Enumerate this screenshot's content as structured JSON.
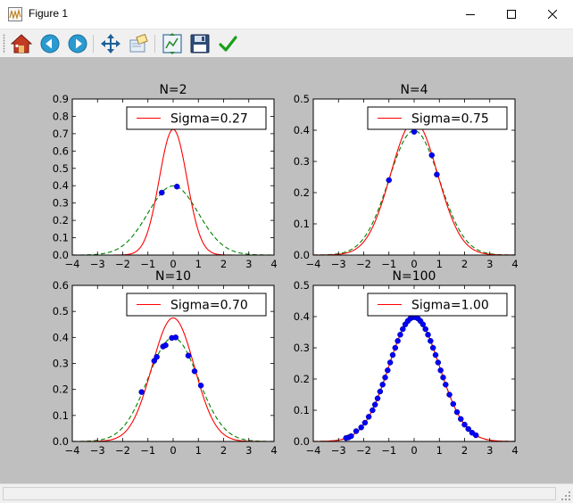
{
  "window": {
    "title": "Figure 1",
    "buttons": {
      "minimize": "minimize",
      "maximize": "maximize",
      "close": "close"
    }
  },
  "toolbar": {
    "tools": [
      {
        "name": "home-icon",
        "label": "Home"
      },
      {
        "name": "back-icon",
        "label": "Back"
      },
      {
        "name": "forward-icon",
        "label": "Forward"
      },
      {
        "name": "pan-icon",
        "label": "Pan"
      },
      {
        "name": "zoom-icon",
        "label": "Zoom"
      },
      {
        "name": "subplots-icon",
        "label": "Subplots"
      },
      {
        "name": "save-icon",
        "label": "Save"
      },
      {
        "name": "edit-icon",
        "label": "Edit"
      }
    ]
  },
  "colors": {
    "fit_line": "#ff0000",
    "true_density": "#007f00",
    "points": "#0000ff",
    "figure_bg": "#bfbfbf",
    "axes_bg": "#ffffff"
  },
  "chart_data": [
    {
      "type": "line",
      "title": "N=2",
      "xlim": [
        -4,
        4
      ],
      "ylim": [
        0,
        0.9
      ],
      "xticks": [
        -4,
        -3,
        -2,
        -1,
        0,
        1,
        2,
        3,
        4
      ],
      "yticks": [
        0.0,
        0.1,
        0.2,
        0.3,
        0.4,
        0.5,
        0.6,
        0.7,
        0.8,
        0.9
      ],
      "ytick_labels": [
        "0.0",
        "0.1",
        "0.2",
        "0.3",
        "0.4",
        "0.5",
        "0.6",
        "0.7",
        "0.8",
        "0.9"
      ],
      "legend": {
        "label": "Sigma=0.27",
        "loc": "top-right"
      },
      "series": [
        {
          "name": "Sigma=0.27",
          "kind": "gaussian",
          "mu": 0.0,
          "sigma": 0.55,
          "color": "#ff0000",
          "style": "solid"
        },
        {
          "kind": "gaussian",
          "mu": 0.0,
          "sigma": 1.0,
          "color": "#007f00",
          "style": "dashed"
        }
      ],
      "points": [
        [
          -0.45,
          0.36
        ],
        [
          0.15,
          0.395
        ]
      ]
    },
    {
      "type": "line",
      "title": "N=4",
      "xlim": [
        -4,
        4
      ],
      "ylim": [
        0,
        0.5
      ],
      "xticks": [
        -4,
        -3,
        -2,
        -1,
        0,
        1,
        2,
        3,
        4
      ],
      "yticks": [
        0.0,
        0.1,
        0.2,
        0.3,
        0.4,
        0.5
      ],
      "ytick_labels": [
        "0.0",
        "0.1",
        "0.2",
        "0.3",
        "0.4",
        "0.5"
      ],
      "legend": {
        "label": "Sigma=0.75",
        "loc": "top-right"
      },
      "series": [
        {
          "name": "Sigma=0.75",
          "kind": "gaussian",
          "mu": 0.0,
          "sigma": 0.93,
          "color": "#ff0000",
          "style": "solid"
        },
        {
          "kind": "gaussian",
          "mu": 0.0,
          "sigma": 1.0,
          "color": "#007f00",
          "style": "dashed"
        }
      ],
      "points": [
        [
          -1.0,
          0.24
        ],
        [
          0.0,
          0.395
        ],
        [
          0.7,
          0.32
        ],
        [
          0.9,
          0.258
        ]
      ]
    },
    {
      "type": "line",
      "title": "N=10",
      "xlim": [
        -4,
        4
      ],
      "ylim": [
        0,
        0.6
      ],
      "xticks": [
        -4,
        -3,
        -2,
        -1,
        0,
        1,
        2,
        3,
        4
      ],
      "yticks": [
        0.0,
        0.1,
        0.2,
        0.3,
        0.4,
        0.5,
        0.6
      ],
      "ytick_labels": [
        "0.0",
        "0.1",
        "0.2",
        "0.3",
        "0.4",
        "0.5",
        "0.6"
      ],
      "legend": {
        "label": "Sigma=0.70",
        "loc": "top-right"
      },
      "series": [
        {
          "name": "Sigma=0.70",
          "kind": "gaussian",
          "mu": 0.0,
          "sigma": 0.84,
          "color": "#ff0000",
          "style": "solid"
        },
        {
          "kind": "gaussian",
          "mu": 0.0,
          "sigma": 1.0,
          "color": "#007f00",
          "style": "dashed"
        }
      ],
      "points": [
        [
          -1.25,
          0.19
        ],
        [
          -0.75,
          0.31
        ],
        [
          -0.65,
          0.325
        ],
        [
          -0.4,
          0.365
        ],
        [
          -0.3,
          0.37
        ],
        [
          -0.05,
          0.398
        ],
        [
          0.1,
          0.4
        ],
        [
          0.6,
          0.33
        ],
        [
          0.85,
          0.27
        ],
        [
          1.1,
          0.215
        ]
      ]
    },
    {
      "type": "line",
      "title": "N=100",
      "xlim": [
        -4,
        4
      ],
      "ylim": [
        0,
        0.5
      ],
      "xticks": [
        -4,
        -3,
        -2,
        -1,
        0,
        1,
        2,
        3,
        4
      ],
      "yticks": [
        0.0,
        0.1,
        0.2,
        0.3,
        0.4,
        0.5
      ],
      "ytick_labels": [
        "0.0",
        "0.1",
        "0.2",
        "0.3",
        "0.4",
        "0.5"
      ],
      "legend": {
        "label": "Sigma=1.00",
        "loc": "top-right"
      },
      "series": [
        {
          "name": "Sigma=1.00",
          "kind": "gaussian",
          "mu": 0.0,
          "sigma": 1.0,
          "color": "#ff0000",
          "style": "solid"
        },
        {
          "kind": "gaussian",
          "mu": 0.0,
          "sigma": 1.0,
          "color": "#007f00",
          "style": "dashed"
        }
      ],
      "points": [
        [
          -2.7,
          0.011
        ],
        [
          -2.6,
          0.013
        ],
        [
          -2.5,
          0.017
        ],
        [
          -2.3,
          0.033
        ],
        [
          -2.1,
          0.045
        ],
        [
          -1.95,
          0.06
        ],
        [
          -1.8,
          0.079
        ],
        [
          -1.65,
          0.1
        ],
        [
          -1.55,
          0.118
        ],
        [
          -1.45,
          0.138
        ],
        [
          -1.35,
          0.16
        ],
        [
          -1.25,
          0.182
        ],
        [
          -1.15,
          0.205
        ],
        [
          -1.05,
          0.228
        ],
        [
          -0.95,
          0.253
        ],
        [
          -0.85,
          0.277
        ],
        [
          -0.75,
          0.3
        ],
        [
          -0.65,
          0.322
        ],
        [
          -0.55,
          0.342
        ],
        [
          -0.45,
          0.36
        ],
        [
          -0.35,
          0.375
        ],
        [
          -0.25,
          0.386
        ],
        [
          -0.15,
          0.394
        ],
        [
          -0.05,
          0.398
        ],
        [
          0.05,
          0.398
        ],
        [
          0.15,
          0.394
        ],
        [
          0.25,
          0.386
        ],
        [
          0.35,
          0.375
        ],
        [
          0.45,
          0.36
        ],
        [
          0.55,
          0.342
        ],
        [
          0.65,
          0.322
        ],
        [
          0.75,
          0.3
        ],
        [
          0.85,
          0.277
        ],
        [
          0.95,
          0.253
        ],
        [
          1.05,
          0.228
        ],
        [
          1.15,
          0.205
        ],
        [
          1.25,
          0.182
        ],
        [
          1.4,
          0.15
        ],
        [
          1.55,
          0.12
        ],
        [
          1.7,
          0.094
        ],
        [
          1.85,
          0.072
        ],
        [
          2.0,
          0.054
        ],
        [
          2.15,
          0.04
        ],
        [
          2.3,
          0.028
        ],
        [
          2.45,
          0.02
        ]
      ]
    }
  ]
}
